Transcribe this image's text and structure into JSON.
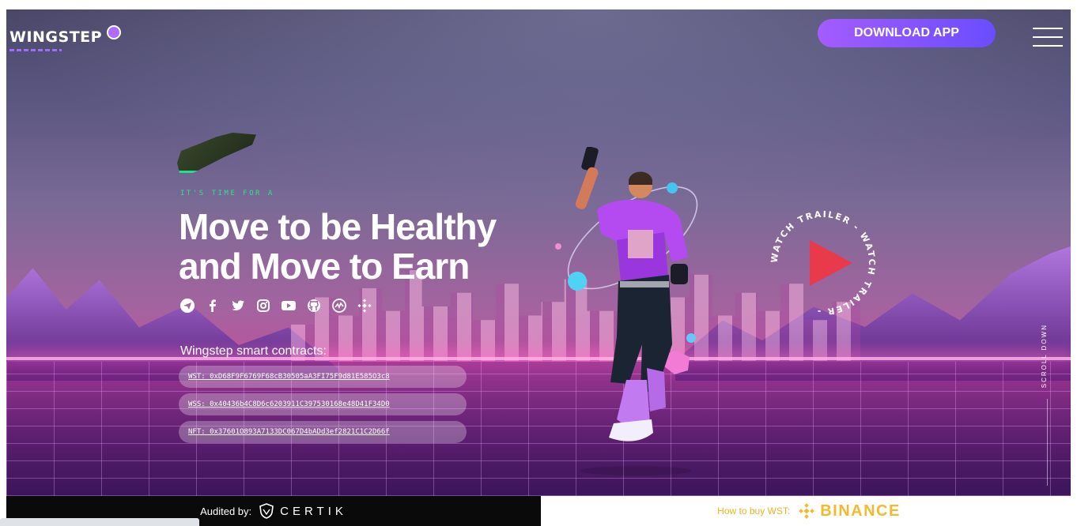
{
  "header": {
    "logo_text": "WINGSTEP",
    "download_label": "DOWNLOAD APP"
  },
  "hero": {
    "tagline": "IT'S TIME FOR A",
    "headline_line1": "Move to be Healthy",
    "headline_line2": "and Move to Earn",
    "social_icons": [
      "telegram-icon",
      "facebook-icon",
      "twitter-icon",
      "instagram-icon",
      "youtube-icon",
      "github-icon",
      "coinmarketcap-icon",
      "binance-icon"
    ],
    "contracts_title": "Wingstep smart contracts:",
    "contracts": [
      "WST: 0xD68F9F6769F68cB30505aA3FI75F9d81E585O3c8",
      "WSS: 0x40436b4C8D6c6203911C397530168e48D41F34D0",
      "NFT: 0x37601O893A7133DC067D4bADd3ef2821C1C2D66f"
    ],
    "trailer_text": "WATCH TRAILER - WATCH TRAILER - ",
    "scroll_text": "SCROLL DOWN"
  },
  "footer": {
    "audited_label": "Audited by:",
    "auditor_name": "CERTIK",
    "buy_label": "How to buy WST:",
    "exchange_name": "BINANCE"
  },
  "colors": {
    "accent": "#a35cff",
    "tagline": "#28e58f",
    "binance": "#f3ba2f"
  }
}
